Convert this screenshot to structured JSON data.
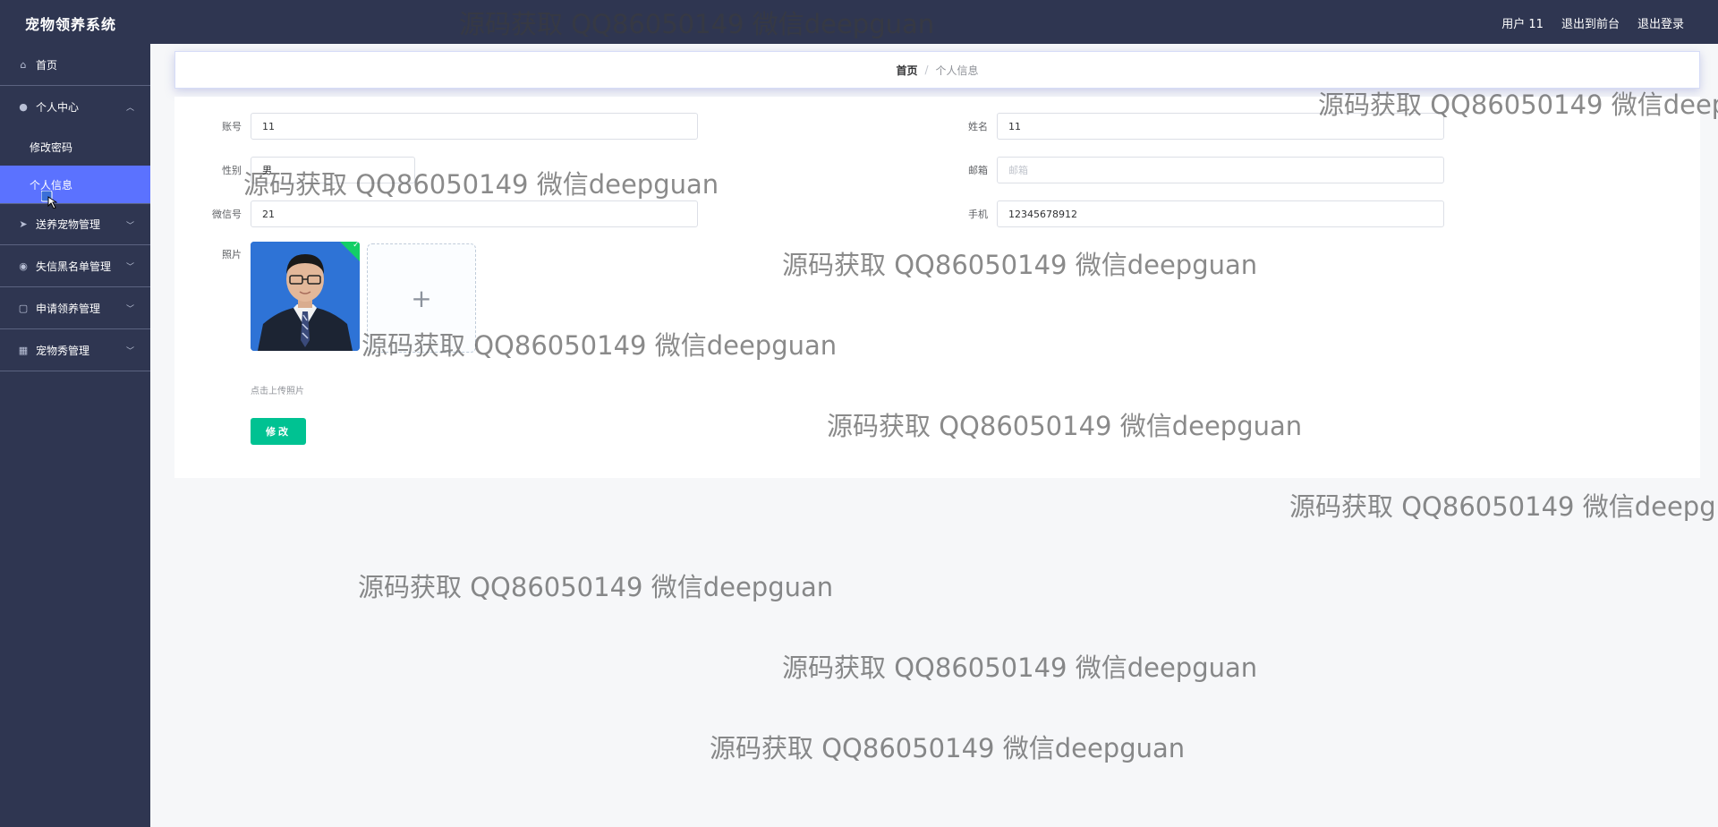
{
  "app": {
    "title": "宠物领养系统"
  },
  "header": {
    "user": "用户 11",
    "to_front": "退出到前台",
    "logout": "退出登录"
  },
  "sidebar": {
    "home": "首页",
    "personal": "个人中心",
    "change_password": "修改密码",
    "personal_info": "个人信息",
    "adoption_mgmt": "送养宠物管理",
    "blacklist_mgmt": "失信黑名单管理",
    "apply_mgmt": "申请领养管理",
    "pet_show_mgmt": "宠物秀管理"
  },
  "breadcrumb": {
    "home": "首页",
    "separator": "/",
    "current": "个人信息"
  },
  "form": {
    "account_label": "账号",
    "account_value": "11",
    "name_label": "姓名",
    "name_value": "11",
    "gender_label": "性别",
    "gender_value": "男",
    "email_label": "邮箱",
    "email_placeholder": "邮箱",
    "wechat_label": "微信号",
    "wechat_value": "21",
    "phone_label": "手机",
    "phone_value": "12345678912",
    "photo_label": "照片",
    "upload_tip": "点击上传照片",
    "submit": "修改"
  },
  "watermark": {
    "text": "源码获取 QQ86050149 微信deepguan"
  },
  "colors": {
    "sidebar": "#2f3651",
    "active": "#5b72ff",
    "submit": "#00c292"
  }
}
